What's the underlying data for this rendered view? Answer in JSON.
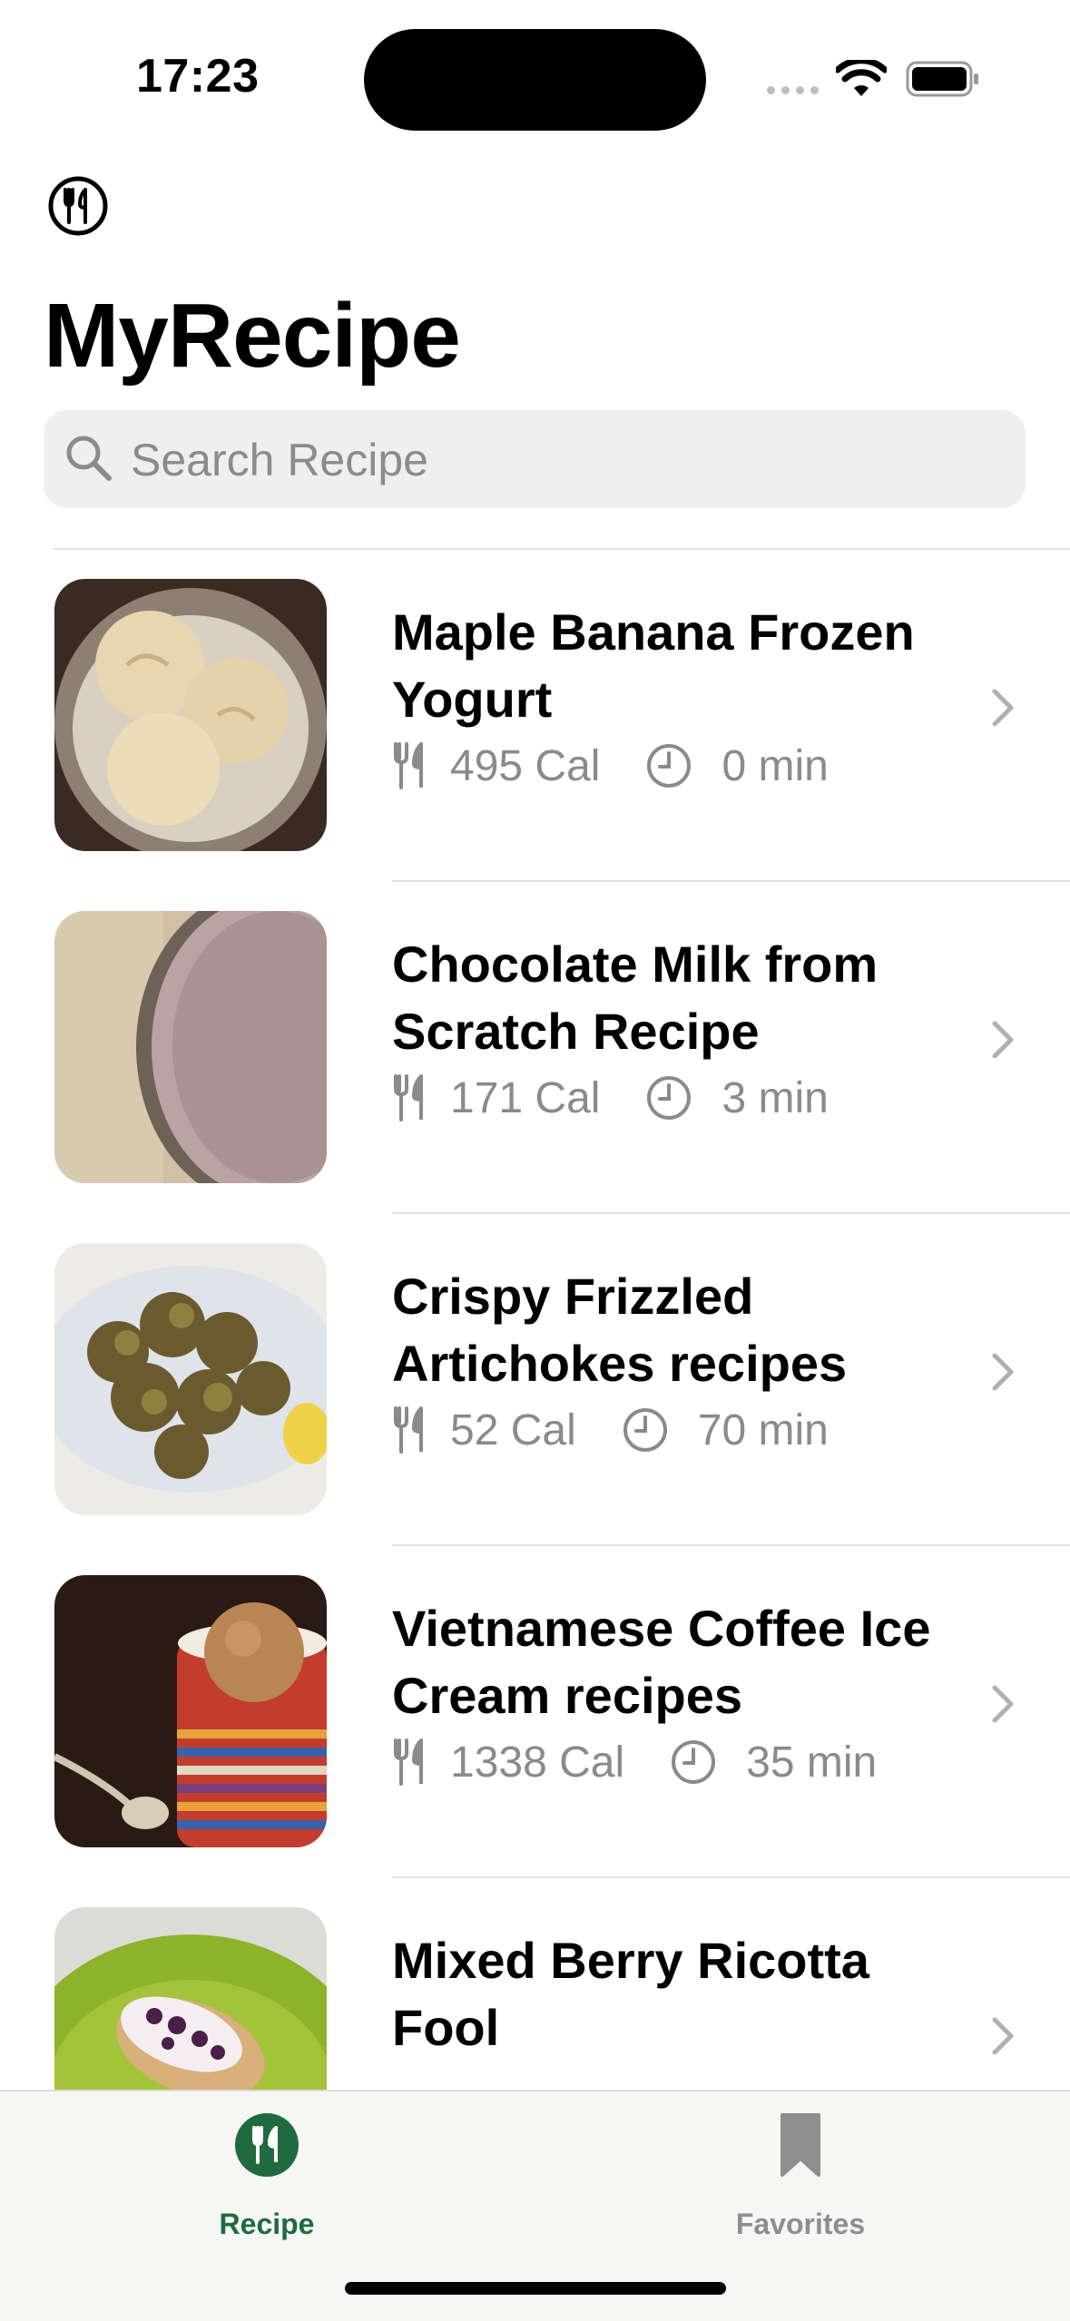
{
  "status_bar": {
    "time": "17:23"
  },
  "header": {
    "title": "MyRecipe",
    "logo_icon": "fork-knife-circle-icon"
  },
  "search": {
    "placeholder": "Search Recipe"
  },
  "recipes": [
    {
      "title": "Maple Banana Frozen Yogurt",
      "calories": "495 Cal",
      "time": "0 min",
      "image": "bowl-of-frozen-yogurt"
    },
    {
      "title": "Chocolate Milk from Scratch Recipe",
      "calories": "171 Cal",
      "time": "3 min",
      "image": "glass-of-chocolate-milk"
    },
    {
      "title": "Crispy Frizzled Artichokes recipes",
      "calories": "52 Cal",
      "time": "70 min",
      "image": "plate-of-fried-artichokes"
    },
    {
      "title": "Vietnamese Coffee Ice Cream recipes",
      "calories": "1338 Cal",
      "time": "35 min",
      "image": "cup-of-coffee-ice-cream"
    },
    {
      "title": "Mixed Berry Ricotta Fool",
      "image": "berry-ricotta-toast-on-plate"
    }
  ],
  "tabbar": {
    "tabs": [
      {
        "label": "Recipe",
        "icon": "fork-knife-circle-icon",
        "selected": true
      },
      {
        "label": "Favorites",
        "icon": "bookmark-icon",
        "selected": false
      }
    ],
    "active_color": "#1f6b3f",
    "inactive_color": "#8e8e8e"
  }
}
